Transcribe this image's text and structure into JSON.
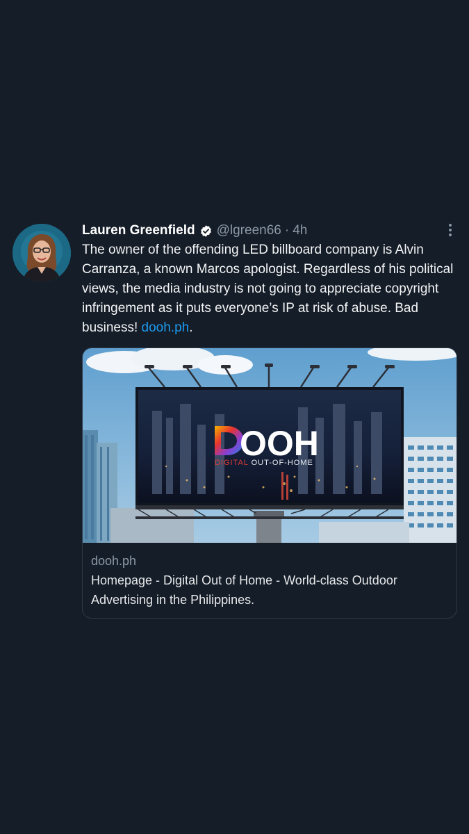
{
  "tweet": {
    "author_name": "Lauren Greenfield",
    "handle": "@lgreen66",
    "separator": "·",
    "time": "4h",
    "text_before_link": "The owner of the offending LED billboard company is Alvin Carranza, a known Marcos apologist. Regardless of his political views, the media industry is not going to appreciate copyright infringement as it puts everyone’s IP at risk of abuse. Bad business! ",
    "link_text": "dooh.ph",
    "text_after_link": ".",
    "verified_icon": "verified-badge-icon",
    "more_icon": "more-options-icon"
  },
  "card": {
    "domain": "dooh.ph",
    "title": "Homepage - Digital Out of Home - World-class Outdoor Advertising in the Philippines.",
    "image_logo_text": "OOH",
    "image_logo_subtitle_a": "DIGITAL",
    "image_logo_subtitle_b": " OUT-OF-HOME"
  },
  "colors": {
    "background": "#151d28",
    "link": "#1d9bf0",
    "muted": "#8b98a5"
  }
}
